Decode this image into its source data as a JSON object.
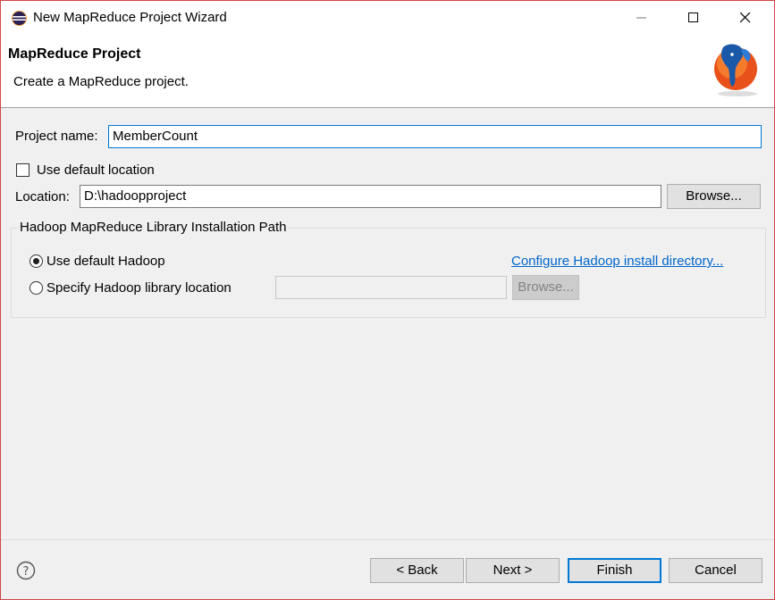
{
  "window": {
    "title": "New MapReduce Project Wizard"
  },
  "banner": {
    "title": "MapReduce Project",
    "description": "Create a MapReduce project."
  },
  "form": {
    "project_name_label": "Project name:",
    "project_name_value": "MemberCount",
    "use_default_location_label": "Use default location",
    "use_default_location_checked": false,
    "location_label": "Location:",
    "location_value": "D:\\hadoopproject",
    "browse_label": "Browse..."
  },
  "hadoop_group": {
    "legend": "Hadoop MapReduce Library Installation Path",
    "use_default_label": "Use default Hadoop",
    "specify_label": "Specify Hadoop library location",
    "configure_link": "Configure Hadoop install directory...",
    "library_path_value": "",
    "browse_label": "Browse..."
  },
  "footer": {
    "back_label": "< Back",
    "next_label": "Next >",
    "finish_label": "Finish",
    "cancel_label": "Cancel"
  },
  "colors": {
    "accent": "#0078d7",
    "link": "#0066cc",
    "window_border": "#d04545"
  }
}
